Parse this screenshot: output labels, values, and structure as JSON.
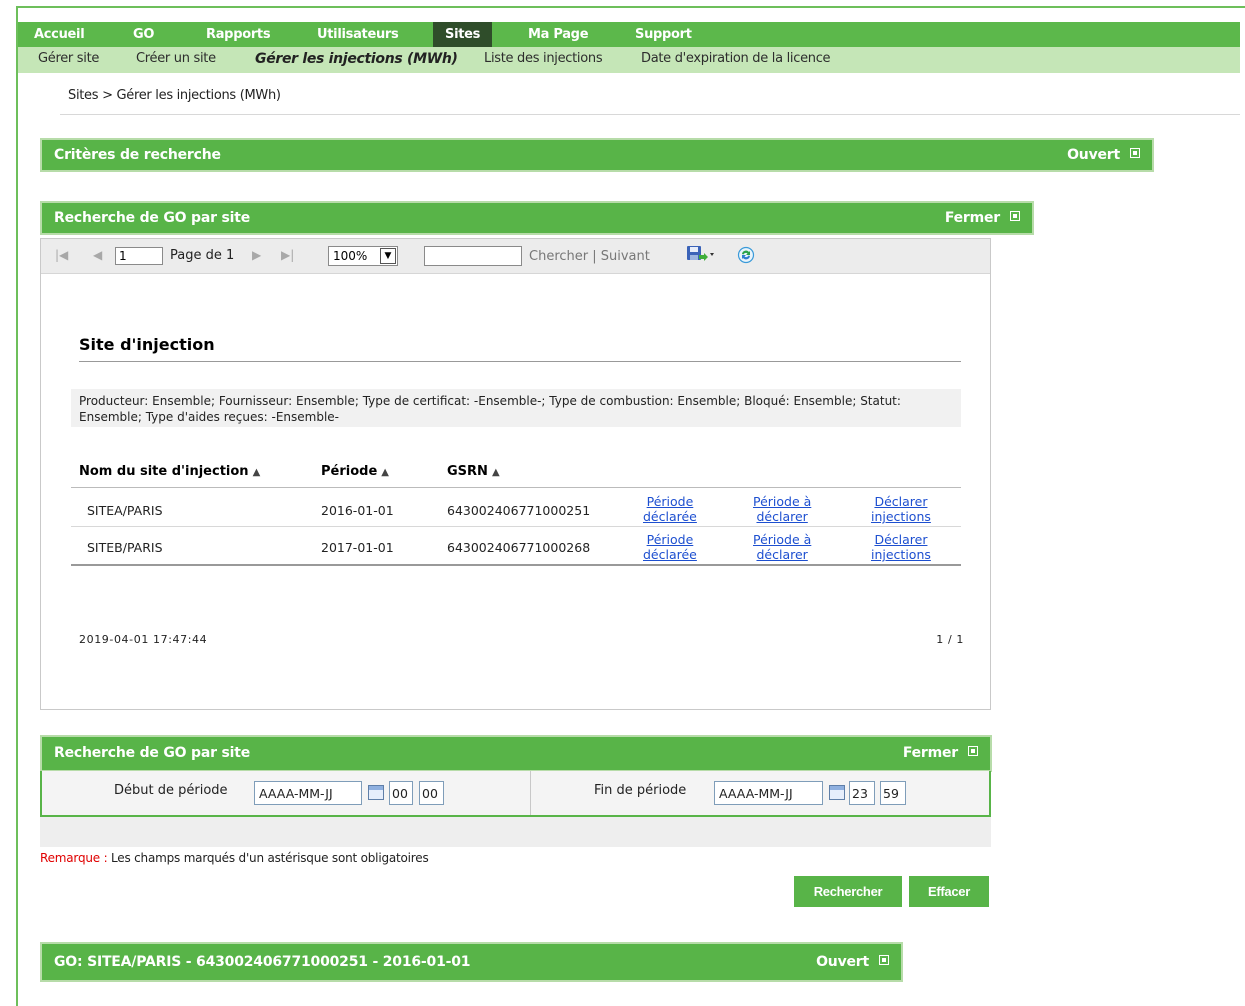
{
  "nav": {
    "items": [
      {
        "label": "Accueil"
      },
      {
        "label": "GO"
      },
      {
        "label": "Rapports"
      },
      {
        "label": "Utilisateurs"
      },
      {
        "label": "Sites"
      },
      {
        "label": "Ma Page"
      },
      {
        "label": "Support"
      }
    ],
    "active": "Sites"
  },
  "subnav": {
    "items": [
      {
        "label": "Gérer site"
      },
      {
        "label": "Créer un site"
      },
      {
        "label": "Gérer les injections (MWh)"
      },
      {
        "label": "Liste des injections"
      },
      {
        "label": "Date d'expiration de la licence"
      }
    ]
  },
  "breadcrumb": {
    "root": "Sites",
    "separator": " > ",
    "current": "Gérer les injections (MWh)"
  },
  "panels": {
    "criteria": {
      "title": "Critères de recherche",
      "toggle": "Ouvert"
    },
    "results": {
      "title": "Recherche de GO par site",
      "toggle": "Fermer"
    },
    "search": {
      "title": "Recherche de GO par site",
      "toggle": "Fermer"
    },
    "go_detail": {
      "title": "GO: SITEA/PARIS - 643002406771000251 - 2016-01-01",
      "toggle": "Ouvert"
    }
  },
  "viewer": {
    "page_value": "1",
    "page_of": "Page de 1",
    "zoom": "100%",
    "find_value": "",
    "find_label": "Chercher",
    "find_sep": " | ",
    "next_label": "Suivant",
    "report": {
      "title": "Site d'injection",
      "criteria_text": "Producteur: Ensemble; Fournisseur: Ensemble; Type de certificat: -Ensemble-; Type de combustion: Ensemble; Bloqué: Ensemble; Statut: Ensemble; Type d'aides reçues: -Ensemble-",
      "columns": [
        "Nom du site d'injection",
        "Période",
        "GSRN"
      ],
      "rows": [
        {
          "name": "SITEA/PARIS",
          "period": "2016-01-01",
          "gsrn": "643002406771000251",
          "link1": [
            "Période",
            "déclarée"
          ],
          "link2": [
            "Période à",
            "déclarer"
          ],
          "link3": [
            "Déclarer",
            "injections"
          ]
        },
        {
          "name": "SITEB/PARIS",
          "period": "2017-01-01",
          "gsrn": "643002406771000268",
          "link1": [
            "Période",
            "déclarée"
          ],
          "link2": [
            "Période à",
            "déclarer"
          ],
          "link3": [
            "Déclarer",
            "injections"
          ]
        }
      ],
      "timestamp": "2019-04-01 17:47:44",
      "page_count": "1 / 1"
    }
  },
  "form": {
    "start_label": "Début de période",
    "start_date": "AAAA-MM-JJ",
    "start_hour": "00",
    "start_min": "00",
    "end_label": "Fin de période",
    "end_date": "AAAA-MM-JJ",
    "end_hour": "23",
    "end_min": "59",
    "remark_prefix": "Remarque :",
    "remark_text": " Les champs marqués d'un astérisque sont obligatoires",
    "search_button": "Rechercher",
    "clear_button": "Effacer"
  },
  "colors": {
    "nav_green": "#5cb84b",
    "nav_active": "#2f4d2a",
    "subnav_bg": "#c5e6b7",
    "link_blue": "#1d4fd0",
    "remark_red": "#e00000"
  }
}
